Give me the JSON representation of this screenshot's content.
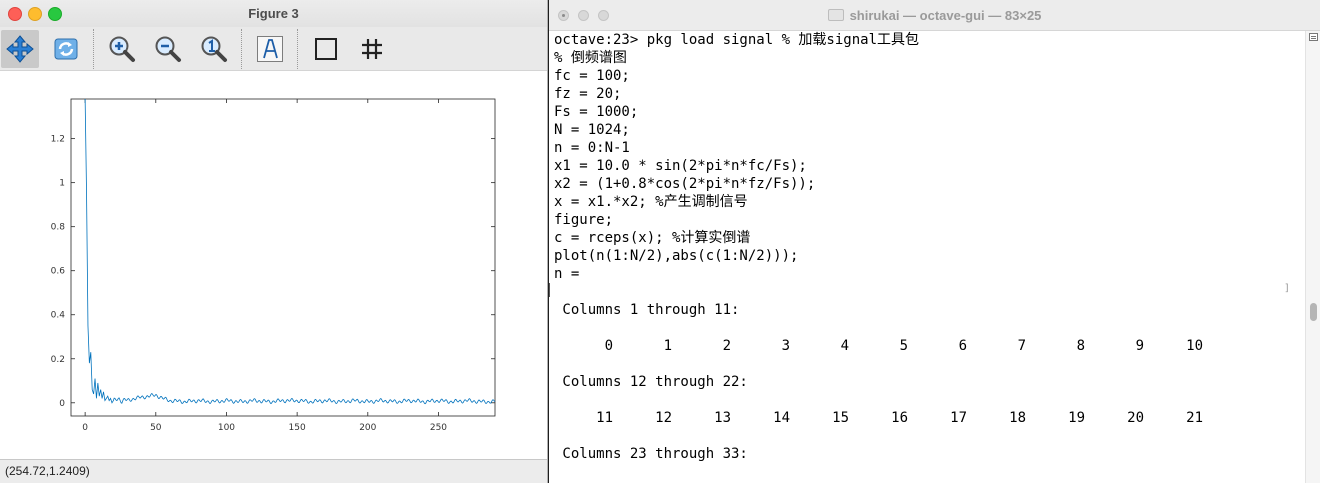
{
  "figure_window": {
    "title": "Figure 3",
    "status": "(254.72,1.2409)",
    "toolbar": [
      {
        "name": "pan-icon",
        "active": true
      },
      {
        "name": "rotate-icon",
        "active": false
      },
      {
        "name": "zoom-in-icon",
        "active": false
      },
      {
        "name": "zoom-out-icon",
        "active": false
      },
      {
        "name": "zoom-reset-icon",
        "active": false
      },
      {
        "name": "insert-text-icon",
        "active": false
      },
      {
        "name": "toggle-box-icon",
        "active": false
      },
      {
        "name": "toggle-grid-icon",
        "active": false
      }
    ]
  },
  "chart_data": {
    "type": "line",
    "title": "",
    "xlabel": "",
    "ylabel": "",
    "xlim": [
      -10,
      290
    ],
    "ylim": [
      -0.06,
      1.38
    ],
    "xticks": [
      0,
      50,
      100,
      150,
      200,
      250
    ],
    "yticks": [
      0,
      0.2,
      0.4,
      0.6,
      0.8,
      1,
      1.2
    ],
    "xtick_labels": [
      "0",
      "50",
      "100",
      "150",
      "200",
      "250"
    ],
    "ytick_labels": [
      "0",
      "0.2",
      "0.4",
      "0.6",
      "0.8",
      "1",
      "1.2"
    ],
    "grid": false,
    "series": [
      {
        "color": "#0072bd",
        "x": [
          0,
          1,
          2,
          3,
          4,
          5,
          6,
          7,
          8,
          9,
          10,
          11,
          12,
          13,
          14,
          15,
          16,
          17,
          18,
          19,
          20,
          22,
          24,
          26,
          28,
          30,
          35,
          40,
          45,
          50,
          55,
          60,
          70,
          80,
          90,
          100,
          110,
          120,
          130,
          140,
          150,
          160,
          170,
          180,
          190,
          200,
          210,
          220,
          230,
          240,
          250,
          260,
          270,
          280,
          290
        ],
        "y": [
          1.38,
          0.95,
          0.35,
          0.18,
          0.23,
          0.06,
          0.04,
          0.11,
          0.02,
          0.09,
          0.03,
          0.06,
          0.02,
          0.05,
          0.01,
          0.02,
          0.03,
          0.01,
          0.02,
          0.0,
          0.01,
          0.015,
          0.02,
          0.005,
          0.015,
          0.01,
          0.02,
          0.025,
          0.03,
          0.035,
          0.02,
          0.01,
          0.005,
          0.01,
          0.005,
          0.01,
          0.005,
          0.01,
          0.005,
          0.01,
          0.01,
          0.005,
          0.01,
          0.005,
          0.01,
          0.005,
          0.01,
          0.005,
          0.01,
          0.005,
          0.01,
          0.005,
          0.01,
          0.005,
          0.005
        ]
      }
    ]
  },
  "terminal_window": {
    "title": "shirukai — octave-gui — 83×25",
    "lines": [
      "octave:23> pkg load signal % 加载signal工具包",
      "% 倒频谱图",
      "fc = 100;",
      "fz = 20;",
      "Fs = 1000;",
      "N = 1024;",
      "n = 0:N-1",
      "x1 = 10.0 * sin(2*pi*n*fc/Fs);",
      "x2 = (1+0.8*cos(2*pi*n*fz/Fs));",
      "x = x1.*x2; %产生调制信号",
      "figure;",
      "c = rceps(x); %计算实倒谱",
      "plot(n(1:N/2),abs(c(1:N/2)));",
      "n =",
      "",
      " Columns 1 through 11:",
      "",
      "      0      1      2      3      4      5      6      7      8      9     10",
      "",
      " Columns 12 through 22:",
      "",
      "     11     12     13     14     15     16     17     18     19     20     21",
      "",
      " Columns 23 through 33:",
      ""
    ]
  }
}
